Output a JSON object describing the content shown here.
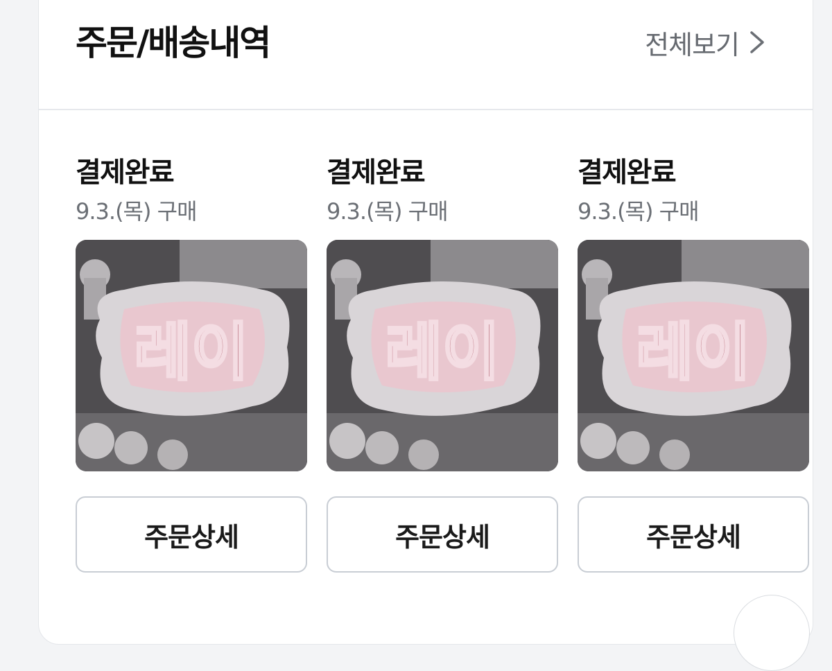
{
  "section": {
    "title": "주문/배송내역",
    "view_all_label": "전체보기"
  },
  "orders": [
    {
      "status": "결제완료",
      "date": "9.3.(목) 구매",
      "detail_label": "주문상세",
      "image_text": "레이"
    },
    {
      "status": "결제완료",
      "date": "9.3.(목) 구매",
      "detail_label": "주문상세",
      "image_text": "레이"
    },
    {
      "status": "결제완료",
      "date": "9.3.(목) 구매",
      "detail_label": "주문상세",
      "image_text": "레이"
    }
  ],
  "icons": {
    "view_all": "chevron-right-icon"
  },
  "colors": {
    "title": "#111111",
    "muted": "#6b6f75",
    "border": "#c8cdd4",
    "divider": "#e6e8ec",
    "product_text": "#b2606e"
  }
}
